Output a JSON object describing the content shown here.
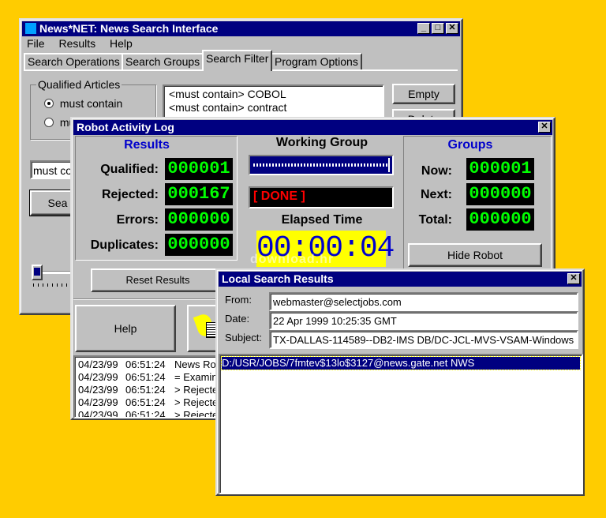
{
  "main_window": {
    "title": "News*NET: News Search Interface",
    "menu": [
      "File",
      "Results",
      "Help"
    ],
    "tabs": [
      "Search Operations",
      "Search Groups",
      "Search Filter",
      "Program Options"
    ],
    "group_title": "Qualified Articles",
    "radio_must_contain": "must contain",
    "radio_must_not": "mu",
    "filters": [
      "<must contain> COBOL",
      "<must contain> contract"
    ],
    "empty_button": "Empty",
    "delete_button": "Delete",
    "text_input": "must co",
    "search_button": "Sea"
  },
  "robot_log": {
    "title": "Robot Activity Log",
    "results_header": "Results",
    "qualified_label": "Qualified:",
    "qualified_value": "000001",
    "rejected_label": "Rejected:",
    "rejected_value": "000167",
    "errors_label": "Errors:",
    "errors_value": "000000",
    "duplicates_label": "Duplicates:",
    "duplicates_value": "000000",
    "working_group_label": "Working Group",
    "status_text": "[ DONE ]",
    "elapsed_label": "Elapsed Time",
    "elapsed_value": "00:00:04",
    "groups_header": "Groups",
    "now_label": "Now:",
    "now_value": "000001",
    "next_label": "Next:",
    "next_value": "000000",
    "total_label": "Total:",
    "total_value": "000000",
    "hide_robot_button": "Hide Robot",
    "reset_results_button": "Reset Results",
    "help_button": "Help",
    "log_lines": [
      {
        "date": "04/23/99",
        "time": "06:51:24",
        "msg": "News Rob"
      },
      {
        "date": "04/23/99",
        "time": "06:51:24",
        "msg": "= Examine"
      },
      {
        "date": "04/23/99",
        "time": "06:51:24",
        "msg": "> Rejecte"
      },
      {
        "date": "04/23/99",
        "time": "06:51:24",
        "msg": "> Rejecte"
      },
      {
        "date": "04/23/99",
        "time": "06:51:24",
        "msg": "> Rejecte"
      }
    ]
  },
  "local_results": {
    "title": "Local Search Results",
    "from_label": "From:",
    "from_value": "webmaster@selectjobs.com",
    "date_label": "Date:",
    "date_value": "22 Apr 1999 10:25:35 GMT",
    "subject_label": "Subject:",
    "subject_value": "TX-DALLAS-114589--DB2-IMS DB/DC-JCL-MVS-VSAM-Windows",
    "selected_path": "D:/USR/JOBS/7fmtev$13lo$3127@news.gate.net NWS"
  },
  "watermark": "download.hr",
  "colors": {
    "desktop": "#FFCC00",
    "titlebar": "#000080",
    "led_green": "#00FF00",
    "header_blue": "#0000CC",
    "status_red": "#FF0000",
    "elapsed_bg": "#FFFF00"
  }
}
